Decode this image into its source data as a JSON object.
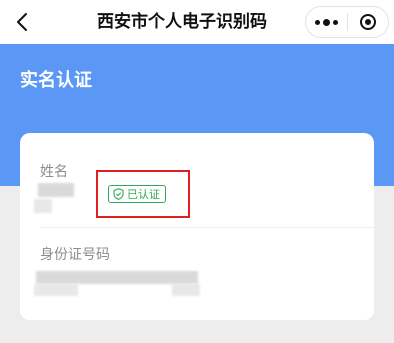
{
  "nav": {
    "title": "西安市个人电子识别码"
  },
  "header": {
    "title": "实名认证"
  },
  "card": {
    "name_label": "姓名",
    "verified_badge": "已认证",
    "id_label": "身份证号码"
  },
  "colors": {
    "brand_blue": "#5b97f5",
    "verified_green": "#2fa956",
    "highlight_red": "#e02020"
  }
}
